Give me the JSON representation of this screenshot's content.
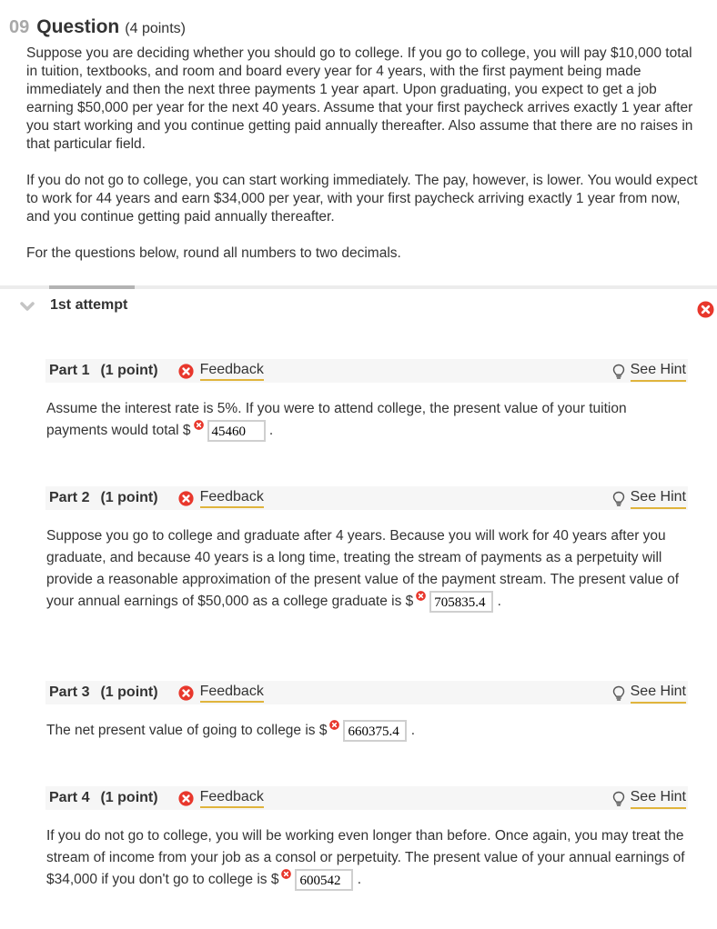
{
  "question": {
    "number": "09",
    "title": "Question",
    "points": "(4 points)",
    "paragraphs": [
      "Suppose you are deciding whether you should go to college. If you go to college, you will pay $10,000 total in tuition, textbooks, and room and board every year for 4 years, with the first payment being made immediately and then the next three payments 1 year apart. Upon graduating, you expect to get a job earning $50,000 per year for the next 40 years. Assume that your first paycheck arrives exactly 1 year after you start working and you continue getting paid annually thereafter. Also assume that there are no raises in that particular field.",
      "If you do not go to college, you can start working immediately. The pay, however, is lower. You would expect to work for 44 years and earn $34,000 per year, with your first paycheck arriving exactly 1 year from now, and you continue getting paid annually thereafter.",
      "For the questions below, round all numbers to two decimals."
    ]
  },
  "attempt": {
    "label": "1st attempt",
    "status_icon": "error-circle-icon",
    "chevron_icon": "chevron-down-icon"
  },
  "colors": {
    "error_red": "#e8372c",
    "link_underline": "#e0b43c",
    "part_header_bg": "#f6f6f6",
    "question_number_gray": "#a8a8a8"
  },
  "parts": [
    {
      "title": "Part 1",
      "points": "(1 point)",
      "feedback_label": "Feedback",
      "hint_label": "See Hint",
      "text_before": "Assume the interest rate is 5%. If you were to attend college, the present value of your tuition payments would total $",
      "answer_value": "45460",
      "text_after": "."
    },
    {
      "title": "Part 2",
      "points": "(1 point)",
      "feedback_label": "Feedback",
      "hint_label": "See Hint",
      "text_before": "Suppose you go to college and graduate after 4 years. Because you will work for 40 years after you graduate, and because 40 years is a long time, treating the stream of payments as a perpetuity will provide a reasonable approximation of the present value of the payment stream. The present value of your annual earnings of $50,000 as a college graduate is $",
      "answer_value": "705835.4",
      "text_after": "."
    },
    {
      "title": "Part 3",
      "points": "(1 point)",
      "feedback_label": "Feedback",
      "hint_label": "See Hint",
      "text_before": "The net present value of going to college is $",
      "answer_value": "660375.4",
      "text_after": "."
    },
    {
      "title": "Part 4",
      "points": "(1 point)",
      "feedback_label": "Feedback",
      "hint_label": "See Hint",
      "text_before": "If you do not go to college, you will be working even longer than before. Once again, you may treat the stream of income from your job as a consol or perpetuity. The present value of your annual earnings of $34,000 if you don't go to college is $",
      "answer_value": "600542",
      "text_after": "."
    }
  ]
}
